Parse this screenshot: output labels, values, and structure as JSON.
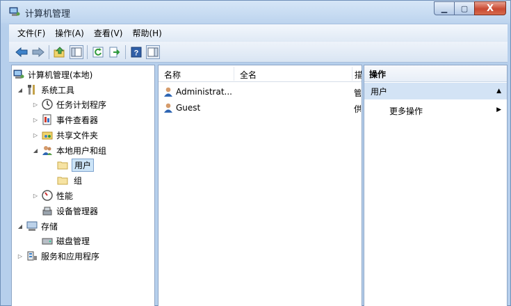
{
  "window": {
    "title": "计算机管理"
  },
  "window_controls": {
    "minimize": "▁",
    "maximize": "▢",
    "close": "X"
  },
  "menu": [
    "文件(F)",
    "操作(A)",
    "查看(V)",
    "帮助(H)"
  ],
  "toolbar_icons": [
    "back-arrow-icon",
    "forward-arrow-icon",
    "up-folder-icon",
    "show-hide-tree-icon",
    "refresh-icon",
    "export-list-icon",
    "help-icon",
    "properties-panel-icon"
  ],
  "tree": {
    "root": "计算机管理(本地)",
    "system_tools": "系统工具",
    "task_scheduler": "任务计划程序",
    "event_viewer": "事件查看器",
    "shared_folders": "共享文件夹",
    "local_users_groups": "本地用户和组",
    "users": "用户",
    "groups": "组",
    "performance": "性能",
    "device_manager": "设备管理器",
    "storage": "存储",
    "disk_management": "磁盘管理",
    "services_apps": "服务和应用程序"
  },
  "list": {
    "columns": [
      "名称",
      "全名",
      "描"
    ],
    "rows": [
      {
        "name": "Administrat...",
        "fullname": "",
        "desc": "管"
      },
      {
        "name": "Guest",
        "fullname": "",
        "desc": "供"
      }
    ]
  },
  "actions": {
    "title": "操作",
    "section": "用户",
    "section_arrow": "▲",
    "more": "更多操作",
    "more_arrow": "▶"
  },
  "colors": {
    "selection_bg": "#cce4f7",
    "action_section_bg": "#d3e3f5",
    "close_button": "#c94a32"
  }
}
